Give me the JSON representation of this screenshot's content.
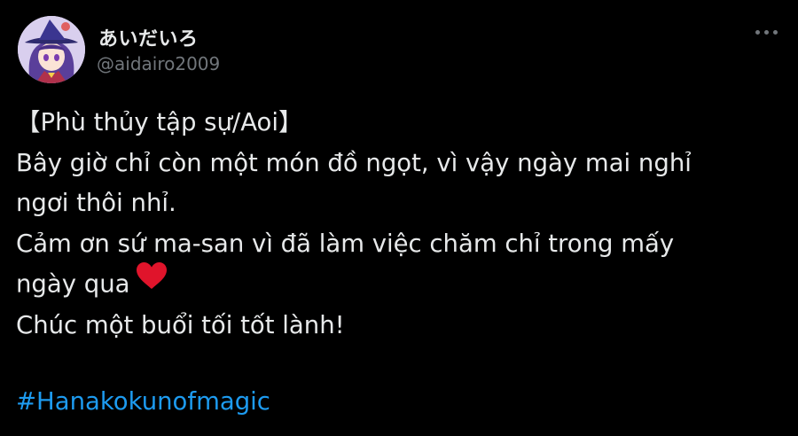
{
  "author": {
    "display_name": "あいだいろ",
    "handle": "@aidairo2009",
    "avatar_icon": "avatar-witch-character"
  },
  "menu": {
    "more_icon": "more-horizontal-icon"
  },
  "tweet": {
    "lines": [
      "【Phù thủy tập sự/Aoi】",
      "Bây giờ chỉ còn một món đồ ngọt, vì vậy ngày mai nghỉ",
      "ngơi thôi nhỉ.",
      "Cảm ơn sứ ma-san vì đã làm việc chăm chỉ trong mấy",
      "ngày qua",
      "Chúc một buổi tối tốt lành!"
    ],
    "emoji": "red-heart",
    "hashtag": "#Hanakokunofmagic"
  },
  "colors": {
    "background": "#000000",
    "text": "#e7e9ea",
    "secondary": "#71767b",
    "link": "#1d9bf0",
    "heart": "#e0142b"
  }
}
